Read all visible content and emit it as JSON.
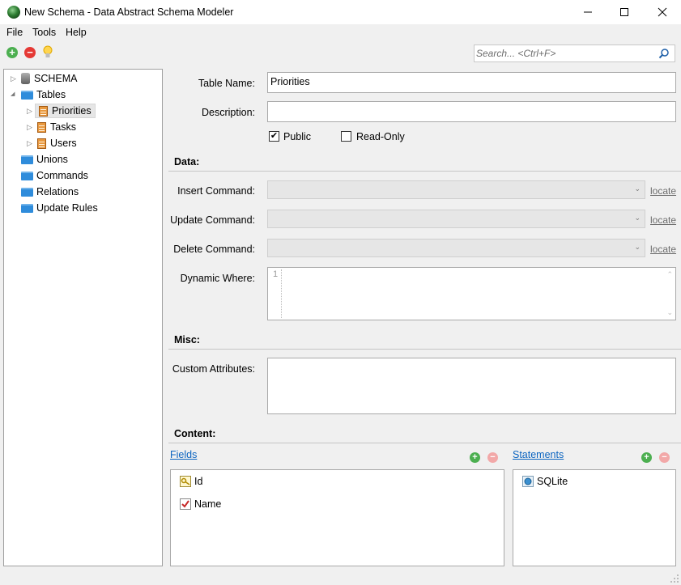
{
  "window": {
    "title": "New Schema - Data Abstract Schema Modeler",
    "minimize_glyph": "—",
    "maximize_glyph": "☐",
    "close_glyph": "✕"
  },
  "menu": {
    "file": "File",
    "tools": "Tools",
    "help": "Help"
  },
  "toolbar": {
    "add_glyph": "+",
    "remove_glyph": "−",
    "add_icon": "add-icon",
    "remove_icon": "remove-icon",
    "hint_icon": "lightbulb-icon"
  },
  "search": {
    "placeholder": "Search... <Ctrl+F>",
    "value": ""
  },
  "tree": {
    "schema": "SCHEMA",
    "tables": "Tables",
    "priorities": "Priorities",
    "tasks": "Tasks",
    "users": "Users",
    "unions": "Unions",
    "commands": "Commands",
    "relations": "Relations",
    "update_rules": "Update Rules",
    "collapsed_glyph": "▷",
    "expanded_glyph": "◢"
  },
  "form": {
    "table_name_label": "Table Name:",
    "table_name_value": "Priorities",
    "description_label": "Description:",
    "description_value": "",
    "public_label": "Public",
    "public_checked": true,
    "readonly_label": "Read-Only",
    "readonly_checked": false,
    "check_glyph": "✔"
  },
  "data_section": {
    "title": "Data:",
    "insert_label": "Insert Command:",
    "update_label": "Update Command:",
    "delete_label": "Delete Command:",
    "locate": "locate",
    "dynamic_where_label": "Dynamic Where:",
    "line_number": "1",
    "chevron": "⌄"
  },
  "misc_section": {
    "title": "Misc:",
    "custom_attributes_label": "Custom Attributes:"
  },
  "content_section": {
    "title": "Content:",
    "fields_link": "Fields",
    "statements_link": "Statements",
    "fields": [
      "Id",
      "Name"
    ],
    "statements": [
      "SQLite"
    ]
  },
  "colors": {
    "accent_link": "#0b64c0",
    "folder_blue": "#2f8cdb",
    "add_green": "#4caf50",
    "remove_red": "#e53935"
  }
}
